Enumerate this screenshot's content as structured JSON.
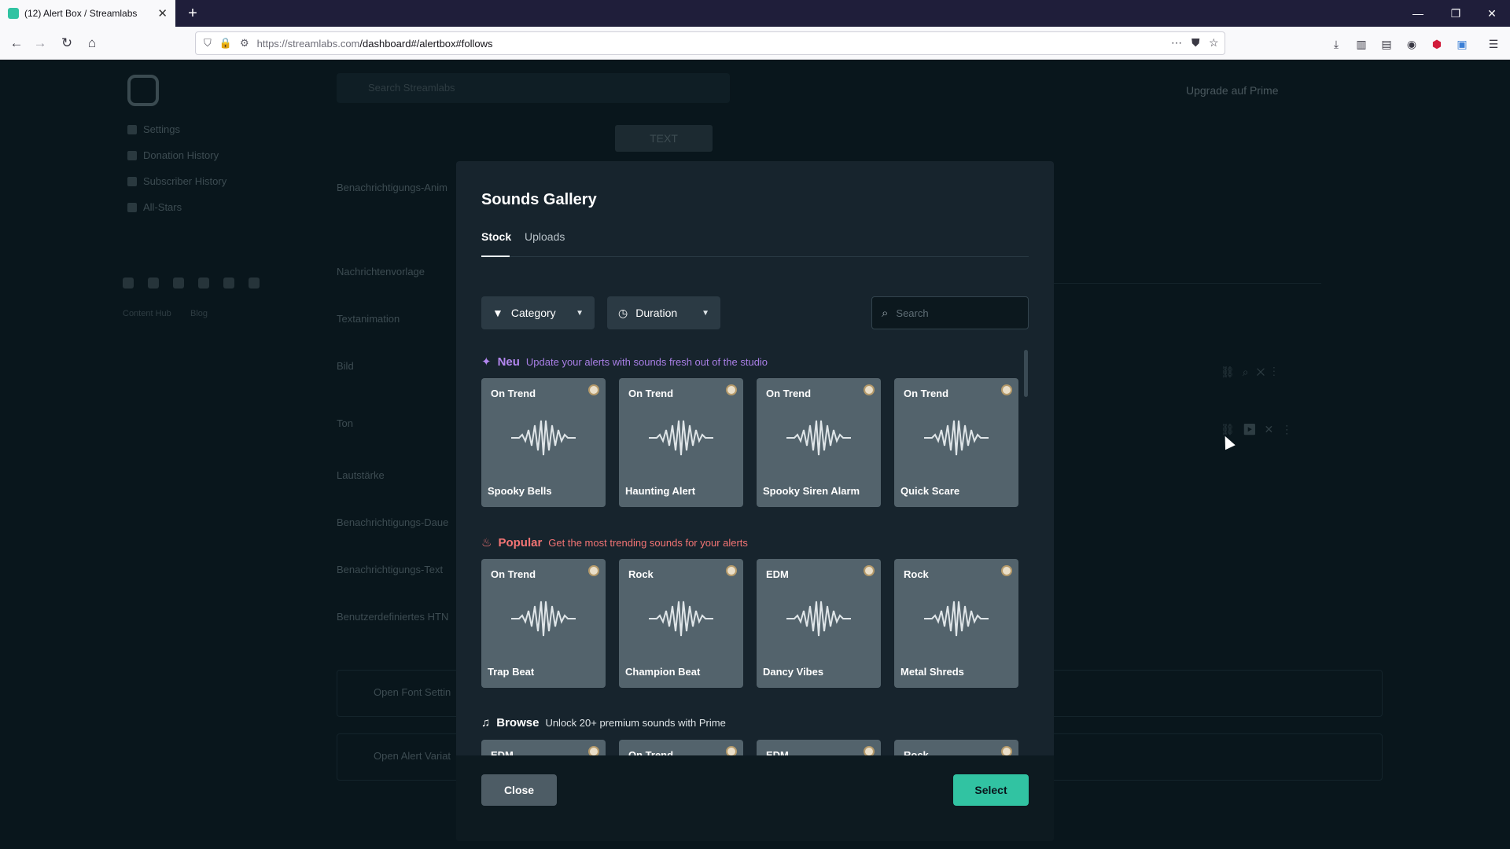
{
  "browser": {
    "tab_title": "(12) Alert Box / Streamlabs",
    "tab_close": "✕",
    "new_tab": "+",
    "url_host": "https://streamlabs.com",
    "url_path": "/dashboard#/alertbox#follows",
    "window_controls": [
      "—",
      "❐",
      "✕"
    ],
    "nav_icons": [
      "back-icon",
      "forward-icon",
      "reload-icon",
      "home-icon"
    ]
  },
  "dashboard": {
    "search_placeholder": "Search Streamlabs",
    "sidebar": [
      "Settings",
      "Donation History",
      "Subscriber History",
      "All-Stars"
    ],
    "footer_links": [
      "Content Hub",
      "Blog"
    ],
    "upgrade_label": "Upgrade auf Prime",
    "type_tab": "TEXT",
    "form_labels": [
      "Benachrichtigungs-Anim",
      "Nachrichtenvorlage",
      "Textanimation",
      "Bild",
      "Ton",
      "Lautstärke",
      "Benachrichtigungs-Daue",
      "Benachrichtigungs-Text",
      "Benutzerdefiniertes HTN"
    ],
    "collapsible": [
      "Open Font Settin",
      "Open Alert Variat"
    ]
  },
  "modal": {
    "title": "Sounds Gallery",
    "tabs": [
      {
        "label": "Stock",
        "active": true
      },
      {
        "label": "Uploads",
        "active": false
      }
    ],
    "filters": {
      "category_label": "Category",
      "duration_label": "Duration"
    },
    "search_placeholder": "Search",
    "sections": {
      "neu": {
        "title": "Neu",
        "description": "Update your alerts with sounds fresh out of the studio",
        "color": "#b387f0",
        "cards": [
          {
            "tag": "On Trend",
            "name": "Spooky Bells"
          },
          {
            "tag": "On Trend",
            "name": "Haunting Alert"
          },
          {
            "tag": "On Trend",
            "name": "Spooky Siren Alarm"
          },
          {
            "tag": "On Trend",
            "name": "Quick Scare"
          }
        ]
      },
      "popular": {
        "title": "Popular",
        "description": "Get the most trending sounds for your alerts",
        "color": "#f37474",
        "cards": [
          {
            "tag": "On Trend",
            "name": "Trap Beat"
          },
          {
            "tag": "Rock",
            "name": "Champion Beat"
          },
          {
            "tag": "EDM",
            "name": "Dancy Vibes"
          },
          {
            "tag": "Rock",
            "name": "Metal Shreds"
          }
        ]
      },
      "browse": {
        "title": "Browse",
        "description": "Unlock 20+ premium sounds with Prime",
        "cards": [
          {
            "tag": "EDM"
          },
          {
            "tag": "On Trend"
          },
          {
            "tag": "EDM"
          },
          {
            "tag": "Rock"
          }
        ]
      }
    },
    "close_label": "Close",
    "select_label": "Select",
    "accent_color": "#31c3a2"
  }
}
